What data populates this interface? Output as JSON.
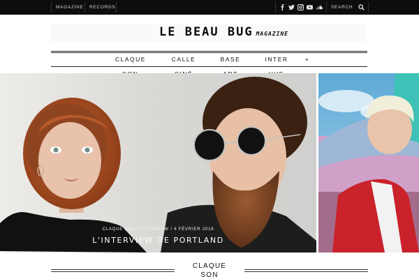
{
  "topbar": {
    "links": [
      "MAGAZINE",
      "RECORDS"
    ],
    "social_icons": [
      "facebook-icon",
      "twitter-icon",
      "instagram-icon",
      "youtube-icon",
      "soundcloud-icon"
    ],
    "search_placeholder": "SEARCH"
  },
  "header": {
    "logo_main": "LE BEAU BUG",
    "logo_sub": "MAGAZINE"
  },
  "nav": {
    "items": [
      {
        "line1": "CLAQUE",
        "line2": "SON"
      },
      {
        "line1": "CALLE",
        "line2": "CINÉ"
      },
      {
        "line1": "BASE",
        "line2": "ART"
      },
      {
        "line1": "INTER",
        "line2": "VUE"
      },
      {
        "line1": "+",
        "line2": ""
      }
    ]
  },
  "featured": {
    "meta": "CLAQUE SON / INTERVIEW / 4 FÉVRIER 2016",
    "title": "L'INTERVIEW DE PORTLAND"
  },
  "section": {
    "title_line1": "CLAQUE",
    "title_line2": "SON"
  },
  "colors": {
    "topbar_bg": "#0d0d0d",
    "text": "#111111"
  }
}
